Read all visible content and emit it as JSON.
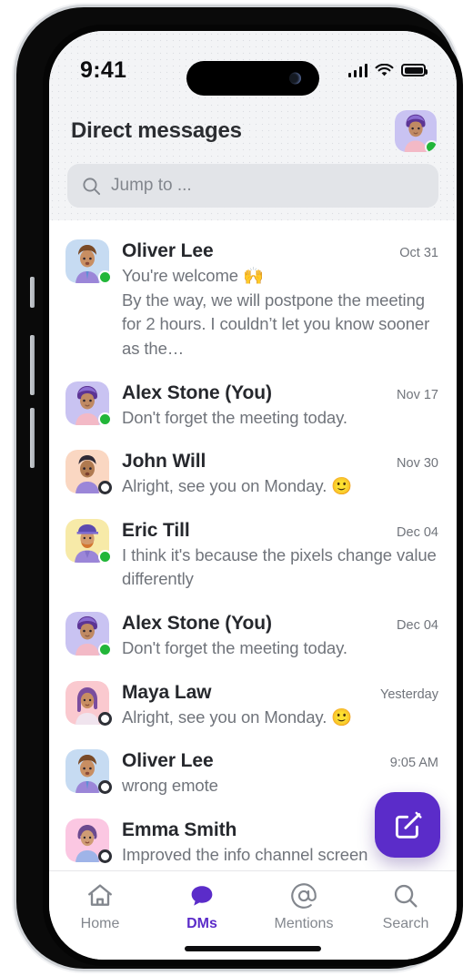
{
  "status_bar": {
    "time": "9:41",
    "signal_icon": "cellular-bars-icon",
    "wifi_icon": "wifi-icon",
    "battery_icon": "battery-full-icon"
  },
  "header": {
    "title": "Direct messages",
    "avatar_name": "current-user-avatar",
    "presence": "online"
  },
  "search": {
    "placeholder": "Jump to ...",
    "icon": "search-icon",
    "value": ""
  },
  "colors": {
    "accent": "#5b2cc9",
    "online": "#22b639",
    "offline_ring": "#2d2f36",
    "text_primary": "#26282d",
    "text_secondary": "#70747b",
    "header_bg": "#f3f4f6",
    "search_bg": "#e2e4e8"
  },
  "conversations": [
    {
      "name": "Oliver Lee",
      "time": "Oct 31",
      "preview": "You're welcome 🙌\nBy the way, we will postpone the meeting for 2 hours. I couldn’t let you know sooner as the…",
      "presence": "online",
      "avatar": "oliver-lee-avatar"
    },
    {
      "name": "Alex Stone (You)",
      "time": "Nov 17",
      "preview": "Don't forget the meeting today.",
      "presence": "online",
      "avatar": "alex-stone-avatar"
    },
    {
      "name": "John Will",
      "time": "Nov 30",
      "preview": "Alright, see you on Monday. 🙂",
      "presence": "offline",
      "avatar": "john-will-avatar"
    },
    {
      "name": "Eric Till",
      "time": "Dec 04",
      "preview": "I think it's because the pixels change value differently",
      "presence": "online",
      "avatar": "eric-till-avatar"
    },
    {
      "name": "Alex Stone (You)",
      "time": "Dec 04",
      "preview": "Don't forget the meeting today.",
      "presence": "online",
      "avatar": "alex-stone-avatar"
    },
    {
      "name": "Maya Law",
      "time": "Yesterday",
      "preview": "Alright, see you on Monday. 🙂",
      "presence": "offline",
      "avatar": "maya-law-avatar"
    },
    {
      "name": "Oliver Lee",
      "time": "9:05 AM",
      "preview": "wrong emote",
      "presence": "offline",
      "avatar": "oliver-lee-avatar"
    },
    {
      "name": "Emma Smith",
      "time": "",
      "preview": "Improved the info channel screen",
      "presence": "offline",
      "avatar": "emma-smith-avatar"
    }
  ],
  "compose_button": {
    "icon": "compose-edit-icon",
    "label": ""
  },
  "tabs": [
    {
      "label": "Home",
      "icon": "home-icon",
      "active": false
    },
    {
      "label": "DMs",
      "icon": "chat-bubble-icon",
      "active": true
    },
    {
      "label": "Mentions",
      "icon": "at-sign-icon",
      "active": false
    },
    {
      "label": "Search",
      "icon": "search-icon",
      "active": false
    }
  ]
}
